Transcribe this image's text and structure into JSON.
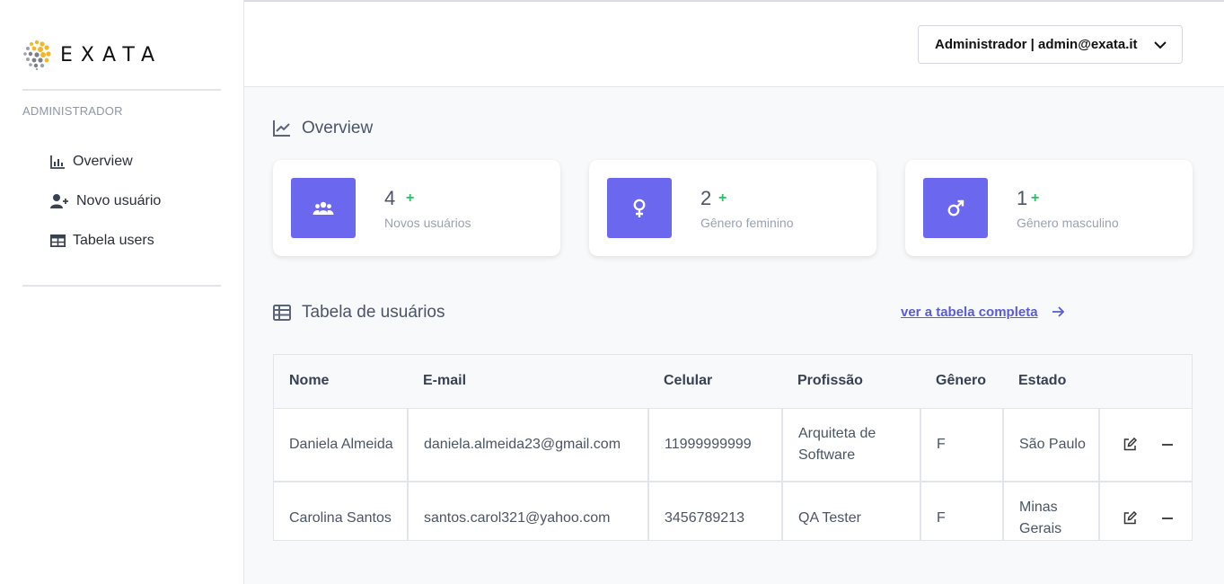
{
  "app": {
    "logo_text": "EXATA",
    "colors": {
      "accent": "#6b68ef",
      "plus": "#22c55e",
      "link": "#5b5bd6",
      "logo_yellow": "#f2b626",
      "logo_gray": "#7a7f8a"
    }
  },
  "sidebar": {
    "section_label": "ADMINISTRADOR",
    "items": [
      {
        "label": "Overview",
        "icon": "bar-chart-icon"
      },
      {
        "label": "Novo usuário",
        "icon": "user-plus-icon"
      },
      {
        "label": "Tabela users",
        "icon": "table-icon"
      }
    ]
  },
  "header": {
    "account_label": "Administrador | admin@exata.it",
    "account_icon": "chevron-down-icon"
  },
  "overview": {
    "title": "Overview",
    "icon": "line-chart-icon",
    "cards": [
      {
        "value": "4",
        "plus": "+",
        "label": "Novos usuários",
        "icon": "users-icon"
      },
      {
        "value": "2",
        "plus": "+",
        "label": "Gênero feminino",
        "icon": "female-icon"
      },
      {
        "value": "1",
        "plus": "+",
        "label": "Gênero masculino",
        "icon": "male-icon"
      }
    ]
  },
  "users_table": {
    "title": "Tabela de usuários",
    "icon": "table-list-icon",
    "link_label": "ver a tabela completa",
    "link_icon": "arrow-right-icon",
    "columns": [
      "Nome",
      "E-mail",
      "Celular",
      "Profissão",
      "Gênero",
      "Estado"
    ],
    "rows": [
      [
        "Daniela Almeida",
        "daniela.almeida23@gmail.com",
        "11999999999",
        "Arquiteta de Software",
        "F",
        "São Paulo"
      ],
      [
        "Carolina Santos",
        "santos.carol321@yahoo.com",
        "3456789213",
        "QA Tester",
        "F",
        "Minas Gerais"
      ]
    ],
    "row_actions": [
      "edit-icon",
      "minus-icon"
    ]
  }
}
